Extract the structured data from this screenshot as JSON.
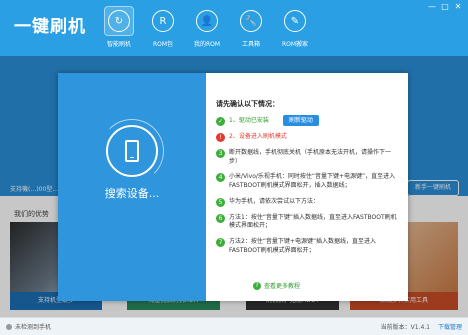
{
  "app": {
    "title": "一键刷机"
  },
  "window_controls": [
    "—",
    "□",
    "✕"
  ],
  "nav": [
    {
      "label": "智能刷机",
      "icon": "smart-flash-icon",
      "glyph": "↻",
      "active": true
    },
    {
      "label": "ROM包",
      "icon": "rom-package-icon",
      "glyph": "R",
      "active": false
    },
    {
      "label": "我的ROM",
      "icon": "my-rom-icon",
      "glyph": "👤",
      "active": false
    },
    {
      "label": "工具箱",
      "icon": "toolbox-icon",
      "glyph": "🔧",
      "active": false
    },
    {
      "label": "ROM搬家",
      "icon": "rom-move-icon",
      "glyph": "✎",
      "active": false
    }
  ],
  "background": {
    "left_text": "支持機(…)00型...",
    "right_button": "新手一键刷机",
    "section_title": "我们的优势",
    "tiles": [
      {
        "caption": "支持机型最多"
      },
      {
        "caption": "海量优质刷机ROM"
      },
      {
        "caption": "刷机快，无需ROOT"
      },
      {
        "caption": "集成多种实用工具"
      }
    ]
  },
  "status": {
    "left": "未检测到手机",
    "version_label": "当前版本：V1.4.1",
    "download_label": "下载管理"
  },
  "modal": {
    "search_text": "搜索设备...",
    "title": "请先确认以下情况：",
    "refresh_button": "刷新驱动",
    "steps": [
      {
        "num": "✓",
        "type": "green",
        "text": "1、驱动已安装",
        "color": "green"
      },
      {
        "num": "!",
        "type": "red",
        "text": "2、设备进入刷机模式",
        "color": "red"
      },
      {
        "num": "3",
        "type": "green",
        "text": "断开数据线，手机彻底关机（手机原本无法开机，请操作下一步）",
        "color": ""
      },
      {
        "num": "4",
        "type": "green",
        "text": "小米/Vivo/乐视手机：同时按住“音量下键+电源键”，直至进入FASTBOOT刷机模式界面松开，插入数据线；",
        "color": ""
      },
      {
        "num": "5",
        "type": "green",
        "text": "华为手机，请依次尝试以下方法：",
        "color": ""
      },
      {
        "num": "6",
        "type": "green",
        "text": "方法1：按住“音量下键”插入数据线，直至进入FASTBOOT刷机模式界面松开；",
        "color": ""
      },
      {
        "num": "7",
        "type": "green",
        "text": "方法2：按住“音量下键+电源键”插入数据线，直至进入FASTBOOT刷机模式界面松开；",
        "color": ""
      }
    ],
    "help_link": "查看更多教程"
  }
}
